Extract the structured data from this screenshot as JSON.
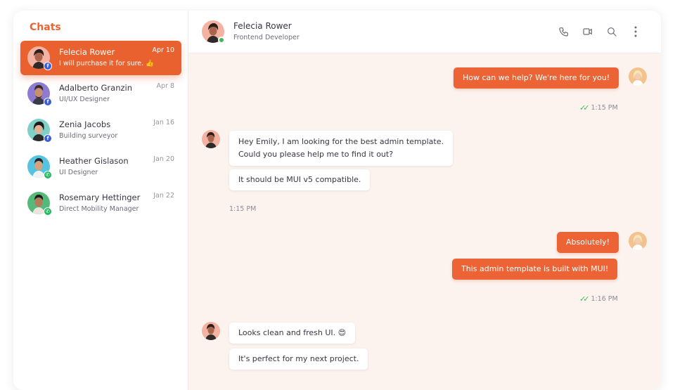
{
  "sidebar": {
    "title": "Chats",
    "chats": [
      {
        "name": "Felecia Rower",
        "subtitle": "I will purchase it for sure. 👍",
        "date": "Apr 10",
        "channel": "facebook",
        "active": true
      },
      {
        "name": "Adalberto Granzin",
        "subtitle": "UI/UX Designer",
        "date": "Apr 8",
        "channel": "facebook",
        "active": false
      },
      {
        "name": "Zenia Jacobs",
        "subtitle": "Building surveyor",
        "date": "Jan 16",
        "channel": "facebook",
        "active": false
      },
      {
        "name": "Heather Gislason",
        "subtitle": "UI Designer",
        "date": "Jan 20",
        "channel": "whatsapp",
        "active": false
      },
      {
        "name": "Rosemary Hettinger",
        "subtitle": "Direct Mobility Manager",
        "date": "Jan 22",
        "channel": "whatsapp",
        "active": false
      }
    ]
  },
  "header": {
    "name": "Felecia Rower",
    "role": "Frontend Developer",
    "icons": [
      "phone-icon",
      "video-icon",
      "search-icon",
      "more-vertical-icon"
    ]
  },
  "messages": [
    {
      "from": "me",
      "text": "How can we help? We're here for you!",
      "time": "1:15 PM"
    },
    {
      "from": "contact",
      "text_line1": "Hey Emily, I am looking for the best admin template.",
      "text_line2": "Could you please help me to find it out?"
    },
    {
      "from": "contact",
      "text": "It should be MUI v5 compatible.",
      "time": "1:15 PM"
    },
    {
      "from": "me",
      "text": "Absolutely!"
    },
    {
      "from": "me",
      "text": "This admin template is built with MUI!",
      "time": "1:16 PM"
    },
    {
      "from": "contact",
      "text": "Looks clean and fresh UI. 😍"
    },
    {
      "from": "contact",
      "text": "It's perfect for my next project."
    }
  ],
  "colors": {
    "accent": "#ec6335",
    "background": "#fcf3ef",
    "online": "#3fb950",
    "facebook": "#3b5ed6",
    "whatsapp": "#25b862"
  }
}
